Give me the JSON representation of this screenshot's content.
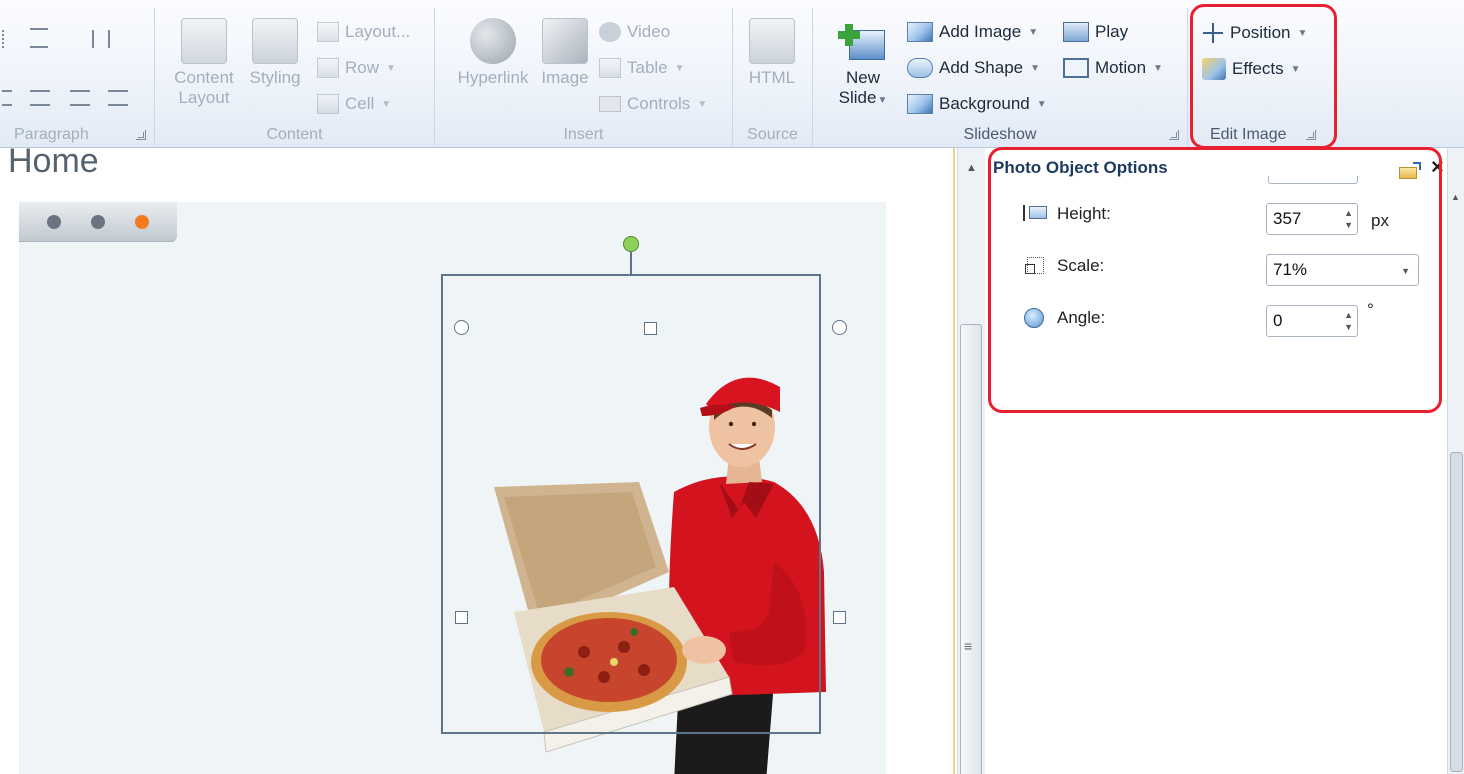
{
  "ribbon": {
    "paragraph": {
      "label": "Paragraph"
    },
    "content": {
      "label": "Content",
      "content_layout": "Content Layout",
      "styling": "Styling",
      "layout": "Layout...",
      "row": "Row",
      "cell": "Cell"
    },
    "insert": {
      "label": "Insert",
      "hyperlink": "Hyperlink",
      "image": "Image",
      "video": "Video",
      "table": "Table",
      "controls": "Controls"
    },
    "source": {
      "label": "Source",
      "html": "HTML"
    },
    "slideshow": {
      "label": "Slideshow",
      "new_slide_line1": "New",
      "new_slide_line2": "Slide",
      "add_image": "Add Image",
      "add_shape": "Add Shape",
      "background": "Background",
      "play": "Play",
      "motion": "Motion"
    },
    "edit_image": {
      "label": "Edit Image",
      "position": "Position",
      "effects": "Effects"
    }
  },
  "document": {
    "page_title": "Home",
    "slideshow_dots": {
      "count": 3,
      "active_index": 2
    }
  },
  "panel": {
    "title": "Photo Object Options",
    "height": {
      "label": "Height:",
      "value": "357",
      "unit": "px"
    },
    "scale": {
      "label": "Scale:",
      "value": "71%"
    },
    "angle": {
      "label": "Angle:",
      "value": "0",
      "unit": "°"
    }
  },
  "colors": {
    "highlight": "#e8202f",
    "active_dot": "#f47a20",
    "slide_bg": "#eff5f6",
    "rotation_handle": "#8fd15a"
  }
}
